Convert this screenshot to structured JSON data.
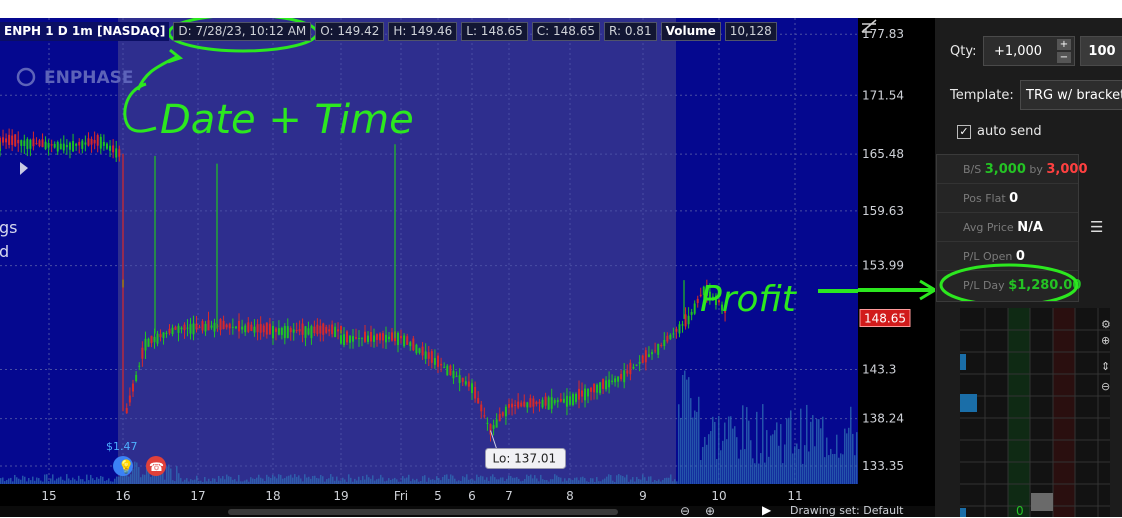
{
  "header": {
    "symbol": "ENPH 1 D 1m [NASDAQ]",
    "date_time": "D: 7/28/23, 10:12 AM",
    "open": "O: 149.42",
    "high": "H: 149.46",
    "low": "L: 148.65",
    "close": "C: 148.65",
    "range": "R: 0.81",
    "volume_label": "Volume",
    "volume_value": "10,128"
  },
  "watermark": "ENPHASE",
  "side_text": [
    "gs",
    "d"
  ],
  "badge_value": "$1.47",
  "lo_label": "Lo: 137.01",
  "last_price": "148.65",
  "annotations": {
    "date_time": "Date + Time",
    "profit": "Profit"
  },
  "bottom_strip": {
    "drawing_set": "Drawing set: Default"
  },
  "chart_data": {
    "type": "candlestick",
    "x_ticks": [
      "15",
      "16",
      "17",
      "18",
      "19",
      "Fri",
      "5",
      "6",
      "7",
      "8",
      "9",
      "10",
      "11"
    ],
    "y_ticks": [
      177.83,
      171.54,
      165.48,
      159.63,
      153.99,
      143.3,
      138.24,
      133.35
    ],
    "ylim": [
      131.5,
      179.5
    ],
    "last_price": 148.65,
    "low_marker": 137.01,
    "price_path": [
      {
        "t": "14.2",
        "price": 166.5
      },
      {
        "t": "14.8",
        "price": 166.9
      },
      {
        "t": "15.2",
        "price": 166.3
      },
      {
        "t": "15.7",
        "price": 166.8
      },
      {
        "t": "15.95",
        "price": 165.5
      },
      {
        "t": "16.05",
        "price": 139.0
      },
      {
        "t": "16.3",
        "price": 146.0
      },
      {
        "t": "16.7",
        "price": 147.5
      },
      {
        "t": "17.3",
        "price": 147.8
      },
      {
        "t": "18.0",
        "price": 147.3
      },
      {
        "t": "19.0",
        "price": 147.3
      },
      {
        "t": "19.8",
        "price": 146.5
      },
      {
        "t": "Fri",
        "price": 146.6
      },
      {
        "t": "5.0",
        "price": 144.0
      },
      {
        "t": "6.0",
        "price": 141.5
      },
      {
        "t": "6.5",
        "price": 137.0
      },
      {
        "t": "7.0",
        "price": 139.5
      },
      {
        "t": "8.0",
        "price": 140.2
      },
      {
        "t": "8.7",
        "price": 142.5
      },
      {
        "t": "9.2",
        "price": 145.5
      },
      {
        "t": "9.6",
        "price": 148.5
      },
      {
        "t": "9.8",
        "price": 151.5
      },
      {
        "t": "10.0",
        "price": 150.3
      },
      {
        "t": "10.12",
        "price": 148.65
      }
    ]
  },
  "right_panel": {
    "qty_label": "Qty:",
    "qty_value": "+1,000",
    "qty_preset": "100",
    "template_label": "Template:",
    "template_value": "TRG w/ bracket",
    "auto_send_label": "auto send",
    "auto_send_checked": true,
    "bs_label": "B/S",
    "bs_buy": "3,000",
    "bs_by": "by",
    "bs_sell": "3,000",
    "pos_flat_label": "Pos Flat",
    "pos_flat_value": "0",
    "avg_price_label": "Avg Price",
    "avg_price_value": "N/A",
    "pl_open_label": "P/L Open",
    "pl_open_value": "0",
    "pl_day_label": "P/L Day",
    "pl_day_value": "$1,280.00",
    "ladder_cell_value": "0"
  }
}
